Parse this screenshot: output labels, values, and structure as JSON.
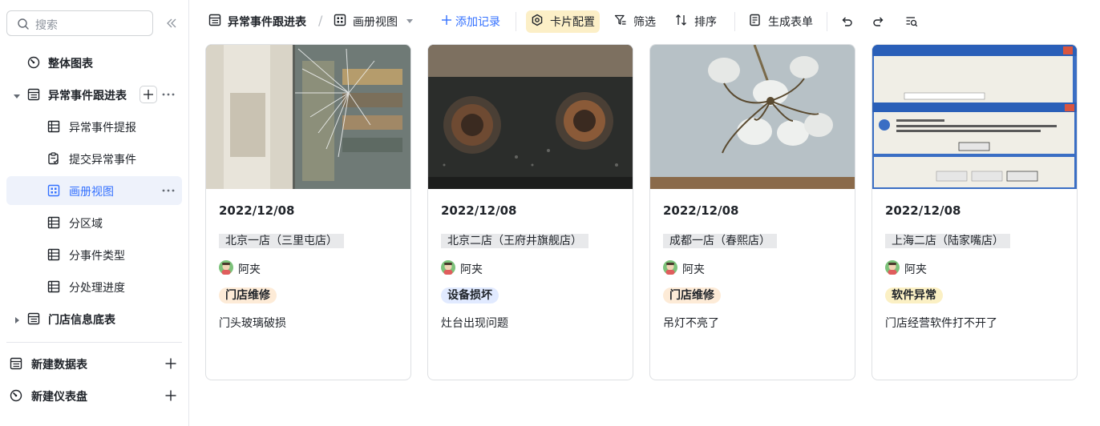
{
  "sidebar": {
    "search_placeholder": "搜索",
    "items": [
      {
        "label": "整体图表"
      },
      {
        "label": "异常事件跟进表"
      },
      {
        "label": "异常事件提报"
      },
      {
        "label": "提交异常事件"
      },
      {
        "label": "画册视图"
      },
      {
        "label": "分区域"
      },
      {
        "label": "分事件类型"
      },
      {
        "label": "分处理进度"
      },
      {
        "label": "门店信息底表"
      }
    ],
    "bottom": [
      {
        "label": "新建数据表"
      },
      {
        "label": "新建仪表盘"
      }
    ]
  },
  "toolbar": {
    "table_name": "异常事件跟进表",
    "view_name": "画册视图",
    "add_record": "添加记录",
    "card_config": "卡片配置",
    "filter": "筛选",
    "sort": "排序",
    "generate_form": "生成表单"
  },
  "cards": [
    {
      "date": "2022/12/08",
      "store": "北京一店（三里屯店）",
      "user": "阿夹",
      "tag": "门店维修",
      "tag_color": "#fdebd7",
      "desc": "门头玻璃破损"
    },
    {
      "date": "2022/12/08",
      "store": "北京二店（王府井旗舰店）",
      "user": "阿夹",
      "tag": "设备损坏",
      "tag_color": "#e1eaff",
      "desc": "灶台出现问题"
    },
    {
      "date": "2022/12/08",
      "store": "成都一店（春熙店）",
      "user": "阿夹",
      "tag": "门店维修",
      "tag_color": "#fdebd7",
      "desc": "吊灯不亮了"
    },
    {
      "date": "2022/12/08",
      "store": "上海二店（陆家嘴店）",
      "user": "阿夹",
      "tag": "软件异常",
      "tag_color": "#fbf0c4",
      "desc": "门店经营软件打不开了"
    }
  ],
  "colors": {
    "accent": "#3370ff",
    "active_bg": "#eef2fb",
    "card_config_bg": "#fcefc7"
  },
  "icons": {
    "search": "search-icon",
    "collapse": "double-chevron-left-icon",
    "dashboard": "dashboard-gauge-icon",
    "table": "table-icon",
    "grid_view": "grid-view-icon",
    "form": "form-icon",
    "gallery": "gallery-icon",
    "add_record": "plus-icon",
    "card_config": "gear-icon",
    "filter": "filter-icon",
    "sort": "sort-icon",
    "generate_form": "form-generate-icon",
    "undo": "undo-icon",
    "redo": "redo-icon",
    "search_records": "search-records-icon"
  }
}
